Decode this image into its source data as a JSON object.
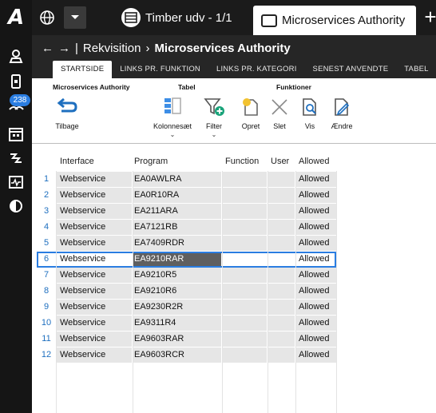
{
  "app": {
    "logo_letter": "A",
    "notification_count": "238"
  },
  "tabs": [
    {
      "label": "Timber udv - 1/1"
    },
    {
      "label": "Microservices Authority"
    }
  ],
  "breadcrumb": {
    "parent": "Rekvisition",
    "separator": "›",
    "current": "Microservices Authority",
    "pipe": "|"
  },
  "ribbon_tabs": [
    "STARTSIDE",
    "LINKS PR. FUNKTION",
    "LINKS PR. KATEGORI",
    "SENEST ANVENDTE",
    "TABEL"
  ],
  "ribbon": {
    "groups": {
      "ms": "Microservices Authority",
      "tabel": "Tabel",
      "funktioner": "Funktioner"
    },
    "buttons": {
      "tilbage": "Tilbage",
      "kolonnesaet": "Kolonnesæt",
      "filter": "Filter",
      "opret": "Opret",
      "slet": "Slet",
      "vis": "Vis",
      "aendre": "Ændre"
    }
  },
  "grid": {
    "columns": [
      "Interface",
      "Program",
      "Function",
      "User",
      "Allowed"
    ],
    "rows": [
      {
        "num": "1",
        "interface": "Webservice",
        "program": "EA0AWLRA",
        "function": "",
        "user": "",
        "allowed": "Allowed"
      },
      {
        "num": "2",
        "interface": "Webservice",
        "program": "EA0R10RA",
        "function": "",
        "user": "",
        "allowed": "Allowed"
      },
      {
        "num": "3",
        "interface": "Webservice",
        "program": "EA211ARA",
        "function": "",
        "user": "",
        "allowed": "Allowed"
      },
      {
        "num": "4",
        "interface": "Webservice",
        "program": "EA7121RB",
        "function": "",
        "user": "",
        "allowed": "Allowed"
      },
      {
        "num": "5",
        "interface": "Webservice",
        "program": "EA7409RDR",
        "function": "",
        "user": "",
        "allowed": "Allowed"
      },
      {
        "num": "6",
        "interface": "Webservice",
        "program": "EA9210RAR",
        "function": "",
        "user": "",
        "allowed": "Allowed"
      },
      {
        "num": "7",
        "interface": "Webservice",
        "program": "EA9210R5",
        "function": "",
        "user": "",
        "allowed": "Allowed"
      },
      {
        "num": "8",
        "interface": "Webservice",
        "program": "EA9210R6",
        "function": "",
        "user": "",
        "allowed": "Allowed"
      },
      {
        "num": "9",
        "interface": "Webservice",
        "program": "EA9230R2R",
        "function": "",
        "user": "",
        "allowed": "Allowed"
      },
      {
        "num": "10",
        "interface": "Webservice",
        "program": "EA9311R4",
        "function": "",
        "user": "",
        "allowed": "Allowed"
      },
      {
        "num": "11",
        "interface": "Webservice",
        "program": "EA9603RAR",
        "function": "",
        "user": "",
        "allowed": "Allowed"
      },
      {
        "num": "12",
        "interface": "Webservice",
        "program": "EA9603RCR",
        "function": "",
        "user": "",
        "allowed": "Allowed"
      }
    ],
    "selected_row": 6
  },
  "colors": {
    "accent": "#2a7de1",
    "rail": "#151515",
    "tabbar": "#1b1b1b",
    "ribbon_tabs": "#262626"
  }
}
